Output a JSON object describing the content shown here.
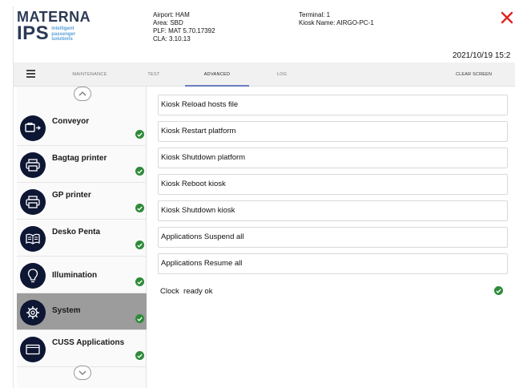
{
  "header": {
    "logo_top": "MATERNA",
    "logo_bottom": "IPS",
    "logo_tagline": [
      "intelligent",
      "passenger",
      "solutions"
    ],
    "info_left": [
      "Airport: HAM",
      "Area: SBD",
      "PLF: MAT 5.70.17392",
      "CLA: 3.10.13"
    ],
    "info_right": [
      "Terminal: 1",
      "Kiosk Name: AIRGO-PC-1"
    ],
    "datetime": "2021/10/19 15:2",
    "close_icon": "close-icon",
    "close_color": "#e02424"
  },
  "tabs": [
    {
      "label": "MAINTENANCE",
      "active": false
    },
    {
      "label": "TEST",
      "active": false
    },
    {
      "label": "ADVANCED",
      "active": true
    },
    {
      "label": "LOG",
      "active": false
    }
  ],
  "clear_screen_label": "CLEAR SCREEN",
  "accent_color": "#6b7fbf",
  "sidebar": {
    "items": [
      {
        "label": "Conveyor",
        "icon": "conveyor-icon",
        "ok": true,
        "active": false
      },
      {
        "label": "Bagtag printer",
        "icon": "printer-icon",
        "ok": true,
        "active": false
      },
      {
        "label": "GP printer",
        "icon": "printer-icon",
        "ok": true,
        "active": false
      },
      {
        "label": "Desko Penta",
        "icon": "passport-reader-icon",
        "ok": true,
        "active": false
      },
      {
        "label": "Illumination",
        "icon": "lightbulb-icon",
        "ok": true,
        "active": false
      },
      {
        "label": "System",
        "icon": "gear-icon",
        "ok": true,
        "active": true
      },
      {
        "label": "CUSS Applications",
        "icon": "window-icon",
        "ok": true,
        "active": false
      }
    ]
  },
  "actions": [
    "Kiosk Reload hosts file",
    "Kiosk Restart platform",
    "Kiosk Shutdown platform",
    "Kiosk Reboot kiosk",
    "Kiosk Shutdown kiosk",
    "Applications Suspend all",
    "Applications Resume all"
  ],
  "status": {
    "text": "Clock  ready ok",
    "ok": true,
    "ok_color": "#2e8b3a"
  }
}
